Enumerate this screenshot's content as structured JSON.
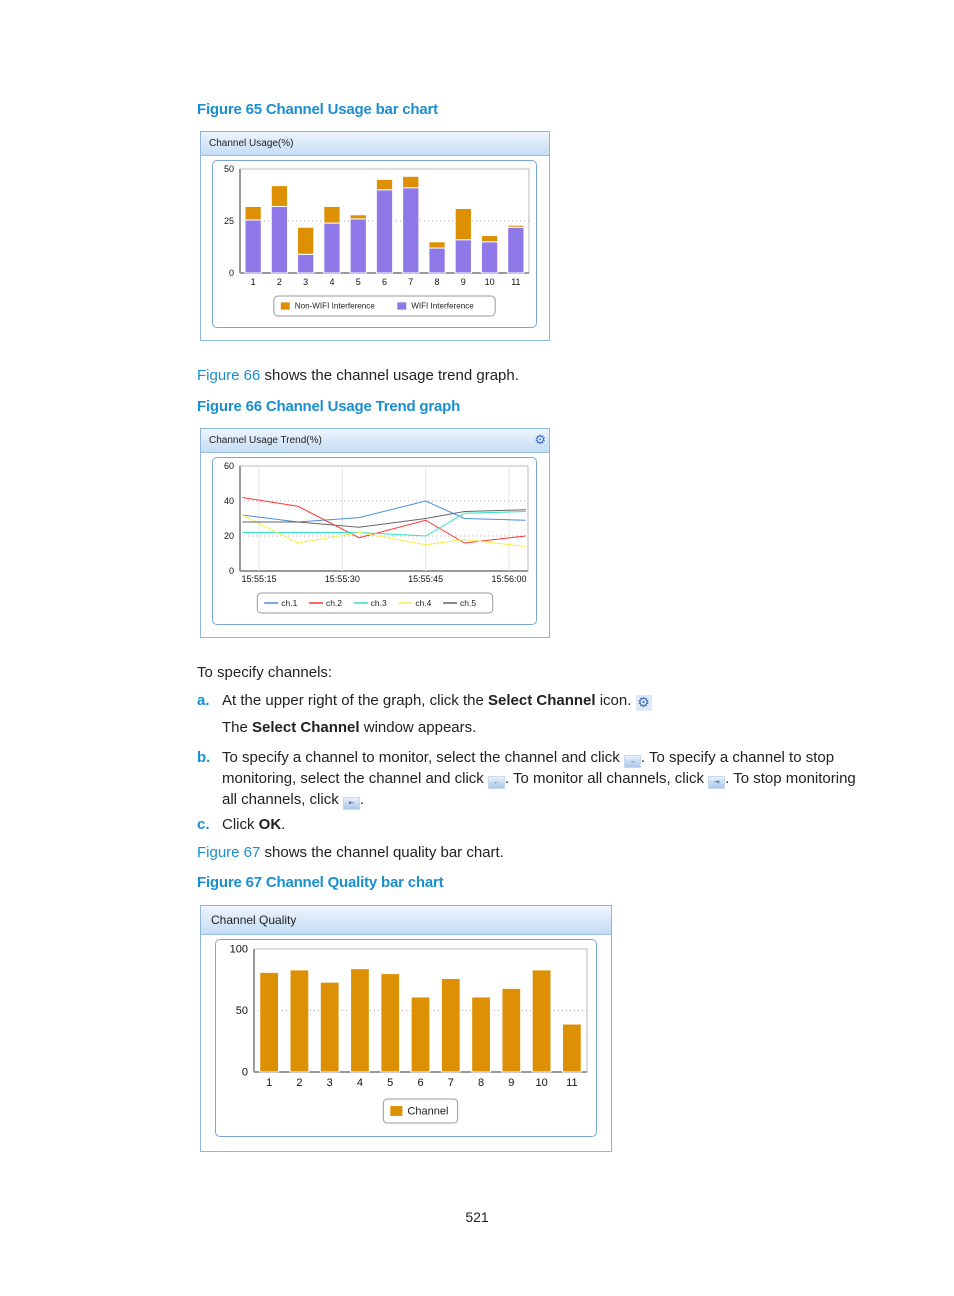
{
  "fig65": {
    "caption": "Figure 65 Channel Usage bar chart",
    "title": "Channel Usage(%)"
  },
  "para66": {
    "link": "Figure 66",
    "text": " shows the channel usage trend graph."
  },
  "fig66": {
    "caption": "Figure 66 Channel Usage Trend graph",
    "title": "Channel Usage Trend(%)",
    "settings_icon": "gear-icon"
  },
  "steps": {
    "intro": "To specify channels:",
    "a": {
      "marker": "a.",
      "pre": "At the upper right of the graph, click the ",
      "bold": "Select Channel",
      "post": " icon.",
      "sub_pre": "The ",
      "sub_bold": "Select Channel",
      "sub_post": " window appears."
    },
    "b": {
      "marker": "b.",
      "t1": "To specify a channel to monitor, select the channel and click ",
      "t2": ". To specify a channel to stop monitoring, select the channel and click ",
      "t3": ". To monitor all channels, click ",
      "t4": ". To stop monitoring all channels, click ",
      "t5": ".",
      "icons": [
        "add-icon",
        "remove-icon",
        "add-all-icon",
        "remove-all-icon"
      ]
    },
    "c": {
      "marker": "c.",
      "pre": "Click ",
      "bold": "OK",
      "post": "."
    }
  },
  "para67": {
    "link": "Figure 67",
    "text": " shows the channel quality bar chart."
  },
  "fig67": {
    "caption": "Figure 67 Channel Quality bar chart",
    "title": "Channel Quality"
  },
  "page_number": "521",
  "chart_data": [
    {
      "type": "bar",
      "stacked": true,
      "title": "Channel Usage(%)",
      "categories": [
        "1",
        "2",
        "3",
        "4",
        "5",
        "6",
        "7",
        "8",
        "9",
        "10",
        "11"
      ],
      "series": [
        {
          "name": "WIFI Interference",
          "color": "#8f79e8",
          "values": [
            25.5,
            32,
            9,
            24,
            26,
            40,
            41,
            12,
            16,
            15,
            22
          ]
        },
        {
          "name": "Non-WIFI Interference",
          "color": "#dd9004",
          "values": [
            6.5,
            10,
            13,
            8,
            2,
            5,
            5.5,
            3,
            15,
            3,
            1
          ]
        }
      ],
      "legend_order": [
        "Non-WIFI Interference",
        "WIFI Interference"
      ],
      "ylim": [
        0,
        50
      ],
      "yticks": [
        0,
        25,
        50
      ],
      "grid": true,
      "legend": "bottom"
    },
    {
      "type": "line",
      "title": "Channel Usage Trend(%)",
      "x": [
        "15:55:12",
        "15:55:22",
        "15:55:33",
        "15:55:45",
        "15:55:52",
        "15:56:03"
      ],
      "series": [
        {
          "name": "ch.1",
          "color": "#4a8fd6",
          "values": [
            32,
            28,
            30.5,
            40,
            30,
            29
          ]
        },
        {
          "name": "ch.2",
          "color": "#ff3333",
          "values": [
            42,
            37,
            19,
            29,
            16,
            20
          ]
        },
        {
          "name": "ch.3",
          "color": "#33e0c0",
          "values": [
            22,
            22,
            22,
            20,
            33,
            34
          ]
        },
        {
          "name": "ch.4",
          "color": "#f5f04a",
          "values": [
            32,
            16,
            22,
            15,
            18,
            14
          ]
        },
        {
          "name": "ch.5",
          "color": "#666666",
          "values": [
            28,
            28,
            25,
            30,
            34,
            35
          ]
        }
      ],
      "xticks": [
        "15:55:15",
        "15:55:30",
        "15:55:45",
        "15:56:00"
      ],
      "ylim": [
        0,
        60
      ],
      "yticks": [
        0,
        20,
        40,
        60
      ],
      "grid": true,
      "legend": "bottom"
    },
    {
      "type": "bar",
      "title": "Channel Quality",
      "categories": [
        "1",
        "2",
        "3",
        "4",
        "5",
        "6",
        "7",
        "8",
        "9",
        "10",
        "11"
      ],
      "series": [
        {
          "name": "Channel",
          "color": "#dd9004",
          "values": [
            81,
            83,
            73,
            84,
            80,
            61,
            76,
            61,
            68,
            83,
            39
          ]
        }
      ],
      "ylim": [
        0,
        100
      ],
      "yticks": [
        0,
        50,
        100
      ],
      "grid": true,
      "legend": "bottom"
    }
  ]
}
